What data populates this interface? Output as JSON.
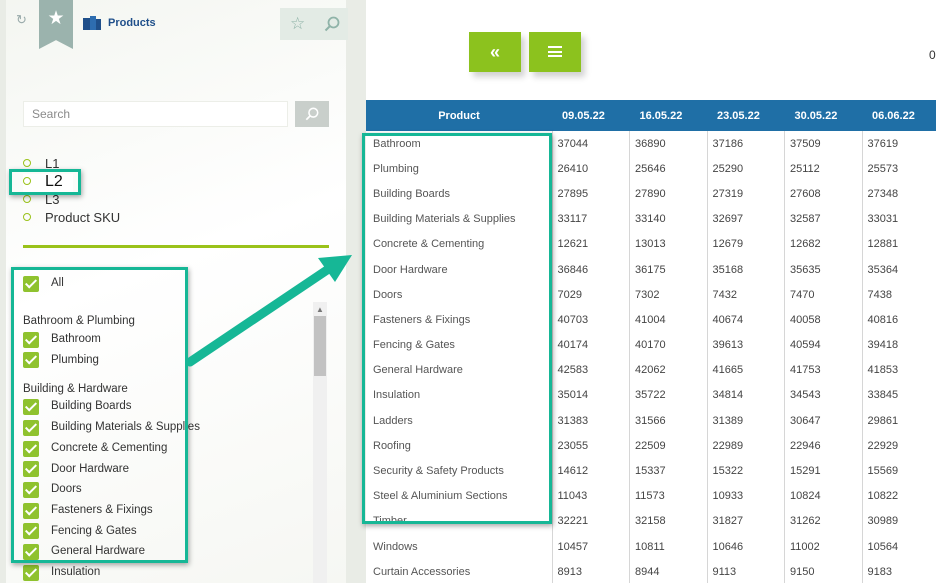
{
  "app": {
    "title": "Products",
    "icons": {
      "refresh": "refresh-icon",
      "favorite": "star-icon",
      "logo": "app-logo-icon",
      "star_outline": "star-outline-icon",
      "search": "search-icon"
    }
  },
  "sidebar": {
    "search": {
      "placeholder": "Search",
      "value": ""
    },
    "levels": [
      {
        "label": "L1",
        "selected": false
      },
      {
        "label": "L2",
        "selected": true
      },
      {
        "label": "L3",
        "selected": false
      },
      {
        "label": "Product SKU",
        "selected": false
      }
    ],
    "all_label": "All",
    "groups": [
      {
        "name": "Bathroom & Plumbing",
        "items": [
          "Bathroom",
          "Plumbing"
        ]
      },
      {
        "name": "Building & Hardware",
        "items": [
          "Building Boards",
          "Building Materials & Supplies",
          "Concrete & Cementing",
          "Door Hardware",
          "Doors",
          "Fasteners & Fixings",
          "Fencing & Gates",
          "General Hardware",
          "Insulation"
        ]
      }
    ]
  },
  "main": {
    "buttons": {
      "collapse": "«",
      "menu": "menu-icon"
    },
    "top_value": "0",
    "table": {
      "headers": [
        "Product",
        "09.05.22",
        "16.05.22",
        "23.05.22",
        "30.05.22",
        "06.06.22"
      ],
      "rows": [
        [
          "Bathroom",
          "37044",
          "36890",
          "37186",
          "37509",
          "37619"
        ],
        [
          "Plumbing",
          "26410",
          "25646",
          "25290",
          "25112",
          "25573"
        ],
        [
          "Building Boards",
          "27895",
          "27890",
          "27319",
          "27608",
          "27348"
        ],
        [
          "Building Materials & Supplies",
          "33117",
          "33140",
          "32697",
          "32587",
          "33031"
        ],
        [
          "Concrete & Cementing",
          "12621",
          "13013",
          "12679",
          "12682",
          "12881"
        ],
        [
          "Door Hardware",
          "36846",
          "36175",
          "35168",
          "35635",
          "35364"
        ],
        [
          "Doors",
          "7029",
          "7302",
          "7432",
          "7470",
          "7438"
        ],
        [
          "Fasteners & Fixings",
          "40703",
          "41004",
          "40674",
          "40058",
          "40816"
        ],
        [
          "Fencing & Gates",
          "40174",
          "40170",
          "39613",
          "40594",
          "39418"
        ],
        [
          "General Hardware",
          "42583",
          "42062",
          "41665",
          "41753",
          "41853"
        ],
        [
          "Insulation",
          "35014",
          "35722",
          "34814",
          "34543",
          "33845"
        ],
        [
          "Ladders",
          "31383",
          "31566",
          "31389",
          "30647",
          "29861"
        ],
        [
          "Roofing",
          "23055",
          "22509",
          "22989",
          "22946",
          "22929"
        ],
        [
          "Security & Safety Products",
          "14612",
          "15337",
          "15322",
          "15291",
          "15569"
        ],
        [
          "Steel & Aluminium Sections",
          "11043",
          "11573",
          "10933",
          "10824",
          "10822"
        ],
        [
          "Timber",
          "32221",
          "32158",
          "31827",
          "31262",
          "30989"
        ],
        [
          "Windows",
          "10457",
          "10811",
          "10646",
          "11002",
          "10564"
        ],
        [
          "Curtain Accessories",
          "8913",
          "8944",
          "9113",
          "9150",
          "9183"
        ]
      ]
    }
  },
  "colors": {
    "accent_green": "#8cc21e",
    "header_blue": "#1f6fa6",
    "highlight_teal": "#16b796"
  }
}
